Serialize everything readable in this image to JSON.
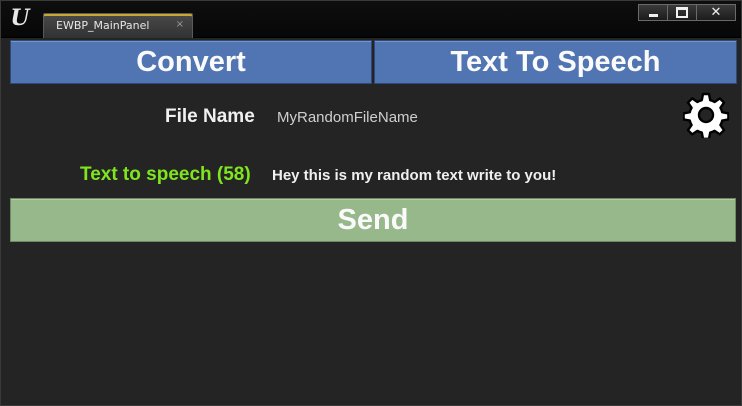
{
  "window": {
    "logo_text": "U",
    "tab_label": "EWBP_MainPanel",
    "tab_close": "×",
    "close_label": "✕"
  },
  "toolbar": {
    "convert_label": "Convert",
    "tts_label": "Text To Speech"
  },
  "form": {
    "file_name_label": "File Name",
    "file_name_value": "MyRandomFileName",
    "tts_label": "Text to speech (58)",
    "tts_value": "Hey this is my random text write to you!"
  },
  "actions": {
    "send_label": "Send"
  },
  "colors": {
    "accent_blue": "#5175b3",
    "send_green": "#97b88b",
    "label_green": "#7fe51e",
    "background": "#242424"
  },
  "icons": {
    "settings": "gear-icon"
  }
}
